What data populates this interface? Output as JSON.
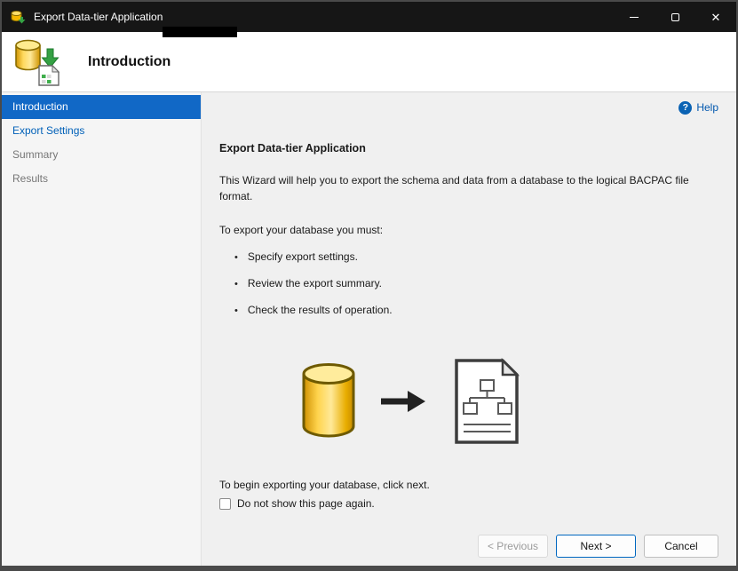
{
  "window": {
    "title": "Export Data-tier Application",
    "close_glyph": "✕"
  },
  "header": {
    "title": "Introduction"
  },
  "sidebar": {
    "items": [
      {
        "label": "Introduction",
        "state": "active"
      },
      {
        "label": "Export Settings",
        "state": "link"
      },
      {
        "label": "Summary",
        "state": "disabled"
      },
      {
        "label": "Results",
        "state": "disabled"
      }
    ]
  },
  "main": {
    "help_label": "Help",
    "help_glyph": "?",
    "heading": "Export Data-tier Application",
    "description": "This Wizard will help you to export the schema and data from a database to the logical BACPAC file format.",
    "requirements_intro": "To export your database you must:",
    "bullets": [
      "Specify export settings.",
      "Review the export summary.",
      "Check the results of operation."
    ],
    "bullet_glyph": "•",
    "begin_text": "To begin exporting your database, click next.",
    "checkbox_label": "Do not show this page again.",
    "checkbox_checked": false
  },
  "footer": {
    "previous_label": "< Previous",
    "next_label": "Next >",
    "cancel_label": "Cancel"
  },
  "colors": {
    "titlebar_bg": "#161616",
    "selected_step_bg": "#1168c6",
    "link_blue": "#0057ae",
    "next_button_border": "#0067c0",
    "cylinder_yellow": "#ffd44d",
    "panel_bg": "#f0f0f0"
  }
}
